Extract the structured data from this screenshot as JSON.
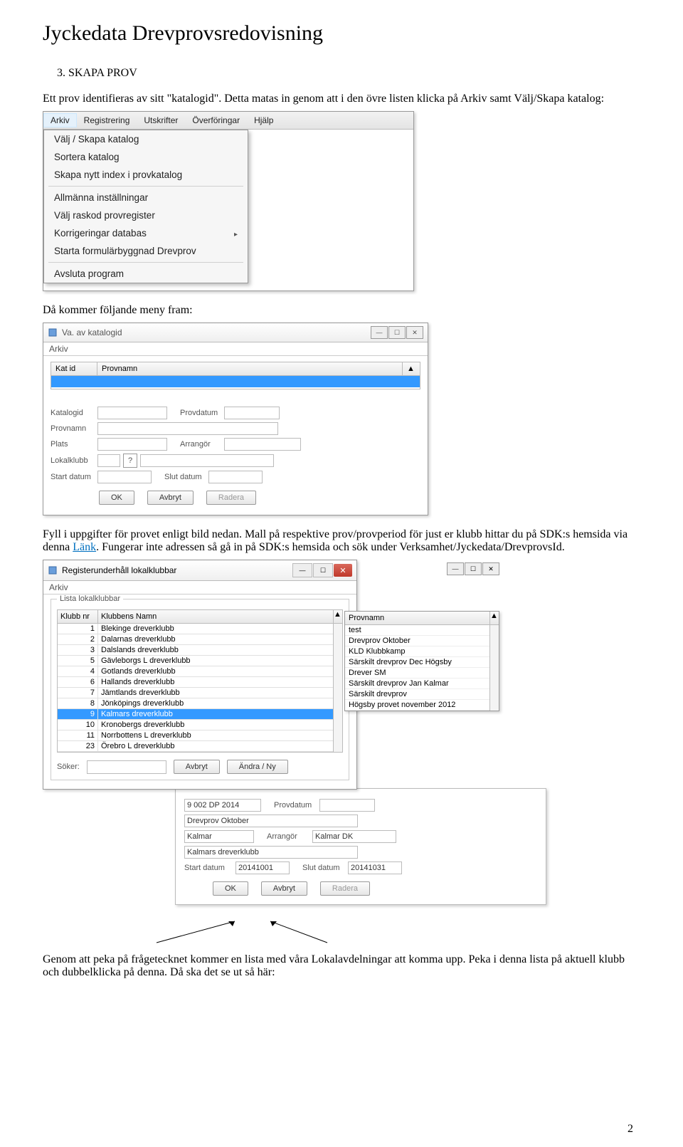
{
  "page": {
    "title": "Jyckedata Drevprovsredovisning",
    "section_number": "3.",
    "section_name": "SKAPA PROV",
    "intro_1": "Ett prov identifieras av sitt \"katalogid\". Detta matas in genom att i den övre listen klicka på Arkiv samt Välj/Skapa katalog:",
    "after_menu": "Då kommer följande meny fram:",
    "after_form_a": "Fyll i uppgifter för provet enligt bild nedan. Mall på respektive prov/provperiod för just er klubb hittar du på SDK:s hemsida via denna ",
    "after_form_link": "Länk",
    "after_form_b": ". Fungerar inte adressen så gå in på SDK:s hemsida och sök under Verksamhet/Jyckedata/DrevprovsId.",
    "final": "Genom att peka på frågetecknet kommer en lista med våra Lokalavdelningar att komma upp. Peka i denna lista på aktuell klubb och dubbelklicka på denna. Då ska det se ut så här:",
    "page_number": "2"
  },
  "menu1": {
    "menubar": [
      "Arkiv",
      "Registrering",
      "Utskrifter",
      "Överföringar",
      "Hjälp"
    ],
    "active_index": 0,
    "dropdown_groups": [
      [
        "Välj / Skapa katalog",
        "Sortera katalog",
        "Skapa nytt index i provkatalog"
      ],
      [
        "Allmänna inställningar",
        "Välj raskod provregister",
        "Korrigeringar databas",
        "Starta formulärbyggnad Drevprov"
      ],
      [
        "Avsluta program"
      ]
    ],
    "has_sub": {
      "Korrigeringar databas": true
    }
  },
  "dialog1": {
    "title": "Va. av katalogid",
    "arkiv_label": "Arkiv",
    "table_headers": [
      "Kat id",
      "Provnamn"
    ],
    "form_labels": {
      "katalogid": "Katalogid",
      "provnamn": "Provnamn",
      "plats": "Plats",
      "lokalklubb": "Lokalklubb",
      "start_datum": "Start datum",
      "provdatum": "Provdatum",
      "arrangor": "Arrangör",
      "slut_datum": "Slut datum"
    },
    "qmark": "?",
    "buttons": {
      "ok": "OK",
      "avbryt": "Avbryt",
      "radera": "Radera"
    }
  },
  "reg": {
    "title": "Registerunderhåll lokalklubbar",
    "arkiv_label": "Arkiv",
    "legend": "Lista lokalklubbar",
    "headers": {
      "c1": "Klubb nr",
      "c2": "Klubbens Namn"
    },
    "rows": [
      {
        "nr": "1",
        "name": "Blekinge dreverklubb"
      },
      {
        "nr": "2",
        "name": "Dalarnas dreverklubb"
      },
      {
        "nr": "3",
        "name": "Dalslands dreverklubb"
      },
      {
        "nr": "5",
        "name": "Gävleborgs L dreverklubb"
      },
      {
        "nr": "4",
        "name": "Gotlands dreverklubb"
      },
      {
        "nr": "6",
        "name": "Hallands dreverklubb"
      },
      {
        "nr": "7",
        "name": "Jämtlands dreverklubb"
      },
      {
        "nr": "8",
        "name": "Jönköpings dreverklubb"
      },
      {
        "nr": "9",
        "name": "Kalmars dreverklubb"
      },
      {
        "nr": "10",
        "name": "Kronobergs dreverklubb"
      },
      {
        "nr": "11",
        "name": "Norrbottens L dreverklubb"
      },
      {
        "nr": "23",
        "name": "Örebro L dreverklubb"
      }
    ],
    "selected_index": 8,
    "footer": {
      "lbl": "Söker:",
      "avbryt": "Avbryt",
      "andra": "Ändra / Ny"
    }
  },
  "rightlist": {
    "header": "Provnamn",
    "rows": [
      "test",
      "Drevprov Oktober",
      "KLD Klubbkamp",
      "Särskilt drevprov Dec Högsby",
      "Drever SM",
      "Särskilt drevprov Jan Kalmar",
      "Särskilt drevprov",
      "Högsby provet november 2012"
    ]
  },
  "dialog2": {
    "katalogid_value": "9 002 DP 2014",
    "provdatum_lbl": "Provdatum",
    "provnamn_value": "Drevprov Oktober",
    "plats_value": "Kalmar",
    "arrangor_lbl": "Arrangör",
    "arrangor_value": "Kalmar DK",
    "lokalklubb_value": "Kalmars dreverklubb",
    "start_datum_lbl": "Start datum",
    "start_datum_value": "20141001",
    "slut_datum_lbl": "Slut datum",
    "slut_datum_value": "20141031",
    "buttons": {
      "ok": "OK",
      "avbryt": "Avbryt",
      "radera": "Radera"
    }
  }
}
